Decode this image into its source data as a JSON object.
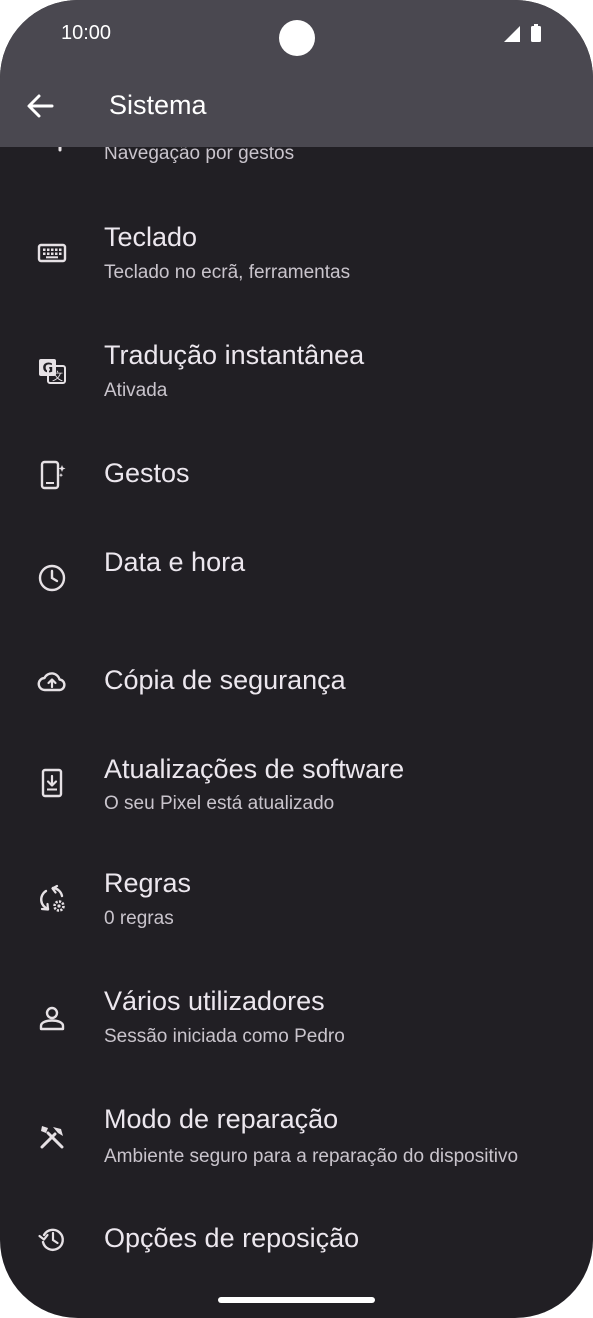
{
  "status_bar": {
    "time": "10:00"
  },
  "app_bar": {
    "title": "Sistema",
    "back_icon": "arrow-back-icon"
  },
  "partial_item": {
    "subtitle": "Navegação por gestos"
  },
  "items": [
    {
      "title": "Teclado",
      "subtitle": "Teclado no ecrã, ferramentas",
      "icon": "keyboard-icon"
    },
    {
      "title": "Tradução instantânea",
      "subtitle": "Ativada",
      "icon": "translate-icon"
    },
    {
      "title": "Gestos",
      "subtitle": "",
      "icon": "gestures-phone-icon"
    },
    {
      "title": "Data e hora",
      "subtitle": "",
      "icon": "clock-icon"
    },
    {
      "title": "Cópia de segurança",
      "subtitle": "",
      "icon": "cloud-upload-icon"
    },
    {
      "title": "Atualizações de software",
      "subtitle": "O seu Pixel está atualizado",
      "icon": "system-update-icon"
    },
    {
      "title": "Regras",
      "subtitle": "0 regras",
      "icon": "rules-sync-gear-icon"
    },
    {
      "title": "Vários utilizadores",
      "subtitle": "Sessão iniciada como Pedro",
      "icon": "person-icon"
    },
    {
      "title": "Modo de reparação",
      "subtitle": "Ambiente seguro para a reparação do dispositivo",
      "icon": "repair-tools-icon"
    },
    {
      "title": "Opções de reposição",
      "subtitle": "",
      "icon": "history-icon"
    }
  ]
}
